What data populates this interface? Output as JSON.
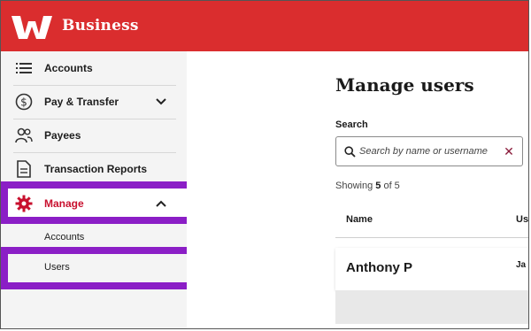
{
  "header": {
    "brand": "Business",
    "logo_icon": "westpac-w-logo",
    "color": "#da2d2e"
  },
  "sidebar": {
    "items": [
      {
        "label": "Accounts",
        "icon": "list-icon"
      },
      {
        "label": "Pay & Transfer",
        "icon": "dollar-circle-icon",
        "chevron": "down"
      },
      {
        "label": "Payees",
        "icon": "people-icon"
      },
      {
        "label": "Transaction Reports",
        "icon": "document-icon"
      },
      {
        "label": "Manage",
        "icon": "gear-icon",
        "chevron": "up",
        "active": true
      }
    ],
    "sub_items": [
      {
        "label": "Accounts"
      },
      {
        "label": "Users"
      }
    ],
    "highlight_color": "#8b1ec6",
    "active_color": "#c8102e"
  },
  "main": {
    "title": "Manage users",
    "search": {
      "label": "Search",
      "placeholder": "Search by name or username",
      "value": ""
    },
    "showing": {
      "prefix": "Showing",
      "count": "5",
      "suffix": "of 5"
    },
    "table": {
      "columns": [
        "Name",
        "Us"
      ],
      "rows": [
        {
          "name": "Anthony P",
          "username": "Ja"
        }
      ]
    }
  }
}
